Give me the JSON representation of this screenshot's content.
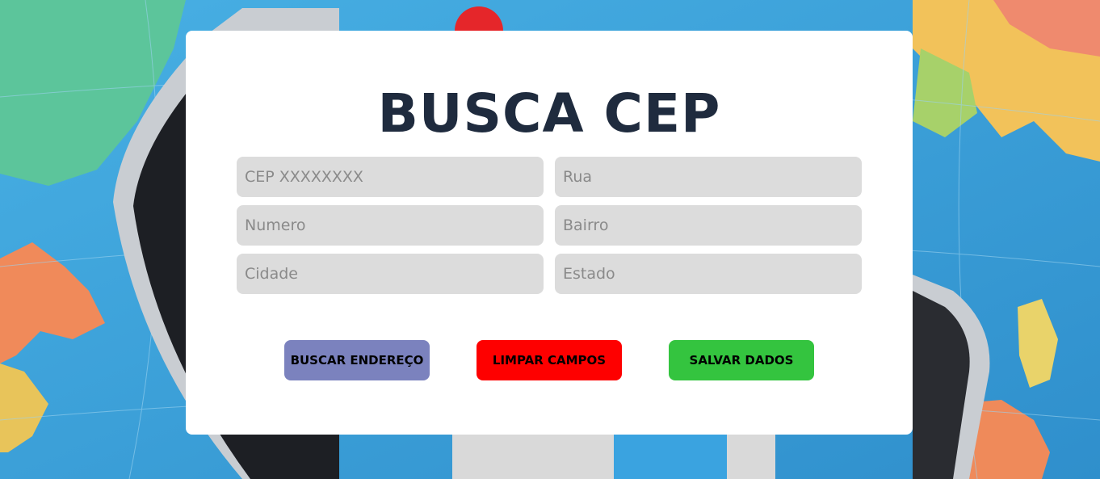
{
  "page": {
    "title": "BUSCA CEP"
  },
  "form": {
    "cep": {
      "placeholder": "CEP XXXXXXXX",
      "value": ""
    },
    "rua": {
      "placeholder": "Rua",
      "value": ""
    },
    "numero": {
      "placeholder": "Numero",
      "value": ""
    },
    "bairro": {
      "placeholder": "Bairro",
      "value": ""
    },
    "cidade": {
      "placeholder": "Cidade",
      "value": ""
    },
    "estado": {
      "placeholder": "Estado",
      "value": ""
    }
  },
  "buttons": {
    "buscar": "BUSCAR ENDEREÇO",
    "limpar": "LIMPAR CAMPOS",
    "salvar": "SALVAR DADOS"
  },
  "colors": {
    "title": "#1f2b3e",
    "field_bg": "#dcdcdc",
    "buscar_bg": "#7b82be",
    "limpar_bg": "#fe0000",
    "salvar_bg": "#34c43f",
    "background_ocean": "#3ea3dc"
  },
  "background": {
    "image": "world-map-with-smartphone"
  }
}
